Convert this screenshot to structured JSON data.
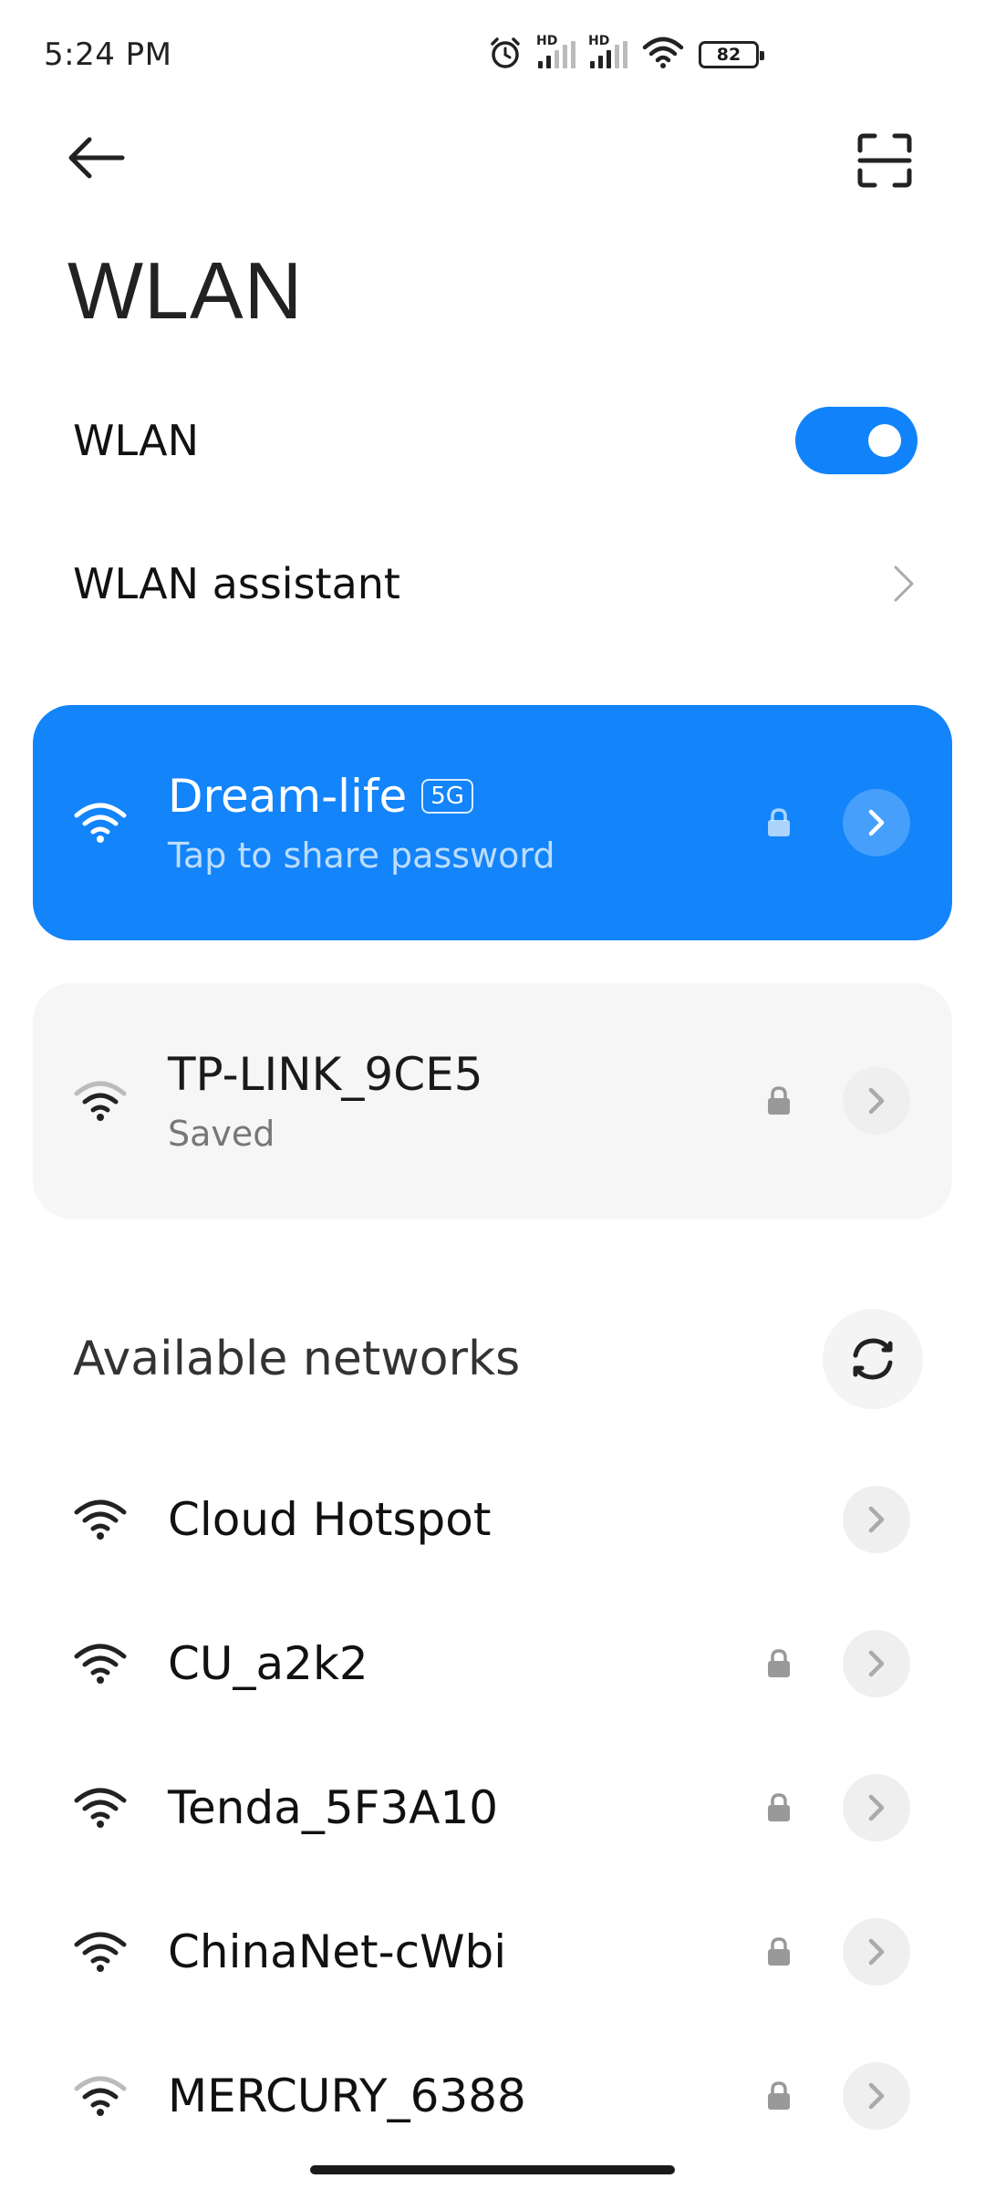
{
  "status_bar": {
    "time": "5:24 PM",
    "battery": "82",
    "signal_label_1": "HD",
    "signal_label_2": "HD",
    "icons": [
      "alarm-icon",
      "signal-icon",
      "signal-icon",
      "wifi-icon",
      "battery-icon"
    ]
  },
  "header": {
    "back_icon": "arrow-left-icon",
    "scan_icon": "scan-icon",
    "title": "WLAN"
  },
  "settings": {
    "wlan_label": "WLAN",
    "wlan_enabled": true,
    "assistant_label": "WLAN assistant"
  },
  "connected_network": {
    "name": "Dream-life",
    "band": "5G",
    "subtitle": "Tap to share password",
    "secured": true
  },
  "saved_network": {
    "name": "TP-LINK_9CE5",
    "subtitle": "Saved",
    "secured": true
  },
  "available": {
    "title": "Available networks",
    "networks": [
      {
        "name": "Cloud Hotspot",
        "secured": false
      },
      {
        "name": "CU_a2k2",
        "secured": true
      },
      {
        "name": "Tenda_5F3A10",
        "secured": true
      },
      {
        "name": "ChinaNet-cWbi",
        "secured": true
      },
      {
        "name": "MERCURY_6388",
        "secured": true
      }
    ]
  },
  "colors": {
    "accent": "#1183fa",
    "card_saved_bg": "#f6f6f6",
    "text_primary": "#111111",
    "text_secondary": "#777777"
  }
}
